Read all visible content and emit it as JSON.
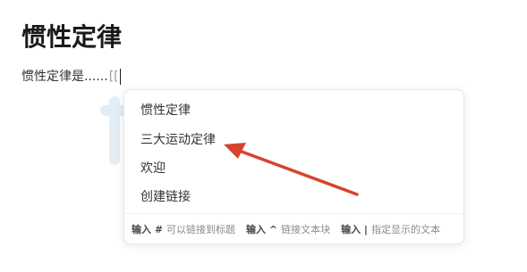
{
  "page": {
    "title": "惯性定律",
    "body_text": "惯性定律是......",
    "link_trigger": "[["
  },
  "link_menu": {
    "items": [
      {
        "label": "惯性定律"
      },
      {
        "label": "三大运动定律"
      },
      {
        "label": "欢迎"
      },
      {
        "label": "创建链接"
      }
    ],
    "hints": [
      {
        "key": "输入 #",
        "text": "可以链接到标题"
      },
      {
        "key": "输入 ^",
        "text": "链接文本块"
      },
      {
        "key": "输入 |",
        "text": "指定显示的文本"
      }
    ]
  },
  "annotation": {
    "arrow_color": "#d6442f",
    "points_to": "三大运动定律"
  },
  "colors": {
    "watermark": "#e3edf5",
    "text": "#333333",
    "hint_text": "#8a8a8a"
  }
}
